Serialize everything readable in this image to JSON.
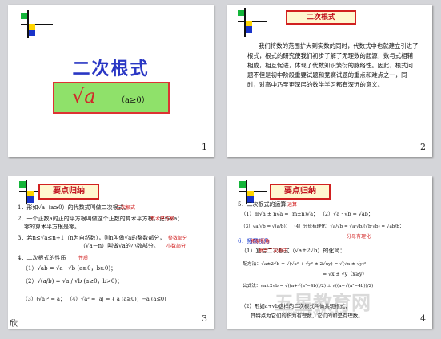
{
  "slides": {
    "s1": {
      "number": "1",
      "title": "二次根式",
      "formula_symbol": "√a",
      "condition": "（a≥0）"
    },
    "s2": {
      "number": "2",
      "title": "二次根式",
      "paragraph": "我们将数的范围扩大到实数的同时，代数式中也就建立引进了根式，根式的研究使我们初步了解了无理数的起源，数与式相辅相成，相互促进，体现了代数知识繁衍的脉络性。因此，根式问题不但是初中阶段重要试题和竞赛试题的重点和难点之一，同时，对高中乃至更深层的数学学习都有深远的意义。"
    },
    "s3": {
      "number": "3",
      "title": "要点归纳",
      "lines": [
        "1．形如√a（a≥0）的代数式叫做二次根式。",
        "2．一个正数a的正的平方根叫做这个正数的算术平方根，记作√a；",
        "零的算术平方根是零。",
        "3．若n≤√a≤n+1（n为自然数），则n叫做√a的整数部分，",
        "（√a－n）叫做√a的小数部分。",
        "4．二次根式的性质",
        "（1）√ab = √a · √b  (a≥0，b≥0)；",
        "（2）√(a/b) = √a / √b  (a≥0，b>0)；",
        "（3）(√a)² = a；  （4）√a² = |a| = { a (a≥0)；−a (a≤0)"
      ],
      "highlight_1": "二次根式",
      "highlight_2": "算术平方根",
      "highlight_3": "整数部分",
      "highlight_4": "小数部分",
      "highlight_5": "性质",
      "corner": "欣"
    },
    "s4": {
      "number": "4",
      "title": "要点归纳",
      "lines": [
        "5．二次根式的运算",
        "（1）m√a ± n√a = (m±n)√a；  （2）√a · √b = √ab；",
        "（3）√a/√b = √(a/b)；  （4）分母有理化：√a/√b = √a·√b/(√b·√b) = √ab/b；",
        "6．拓展视角",
        "（1）复合二次根式（√a±2√b）的化简：",
        "配方法：√a±2√b = √(√x² + √y² ± 2√xy) = √(√x ± √y)²",
        "= √x ± √y（x≥y）",
        "公式法：√a±2√b = √((a+√(a²−4b))/2) ± √((a−√(a²−4b))/2)",
        "（2）形如a+√b这样的二次根式叫做共轭根式，",
        "其特点为它们的积为有理数，它们的和是有理数。"
      ],
      "highlight_1": "运算",
      "highlight_2": "分母有理化",
      "highlight_3": "拓展视角",
      "highlight_4": "复合二次根式",
      "watermark": "www.5ykj.com",
      "watermark_cn": "五星教育网"
    }
  }
}
